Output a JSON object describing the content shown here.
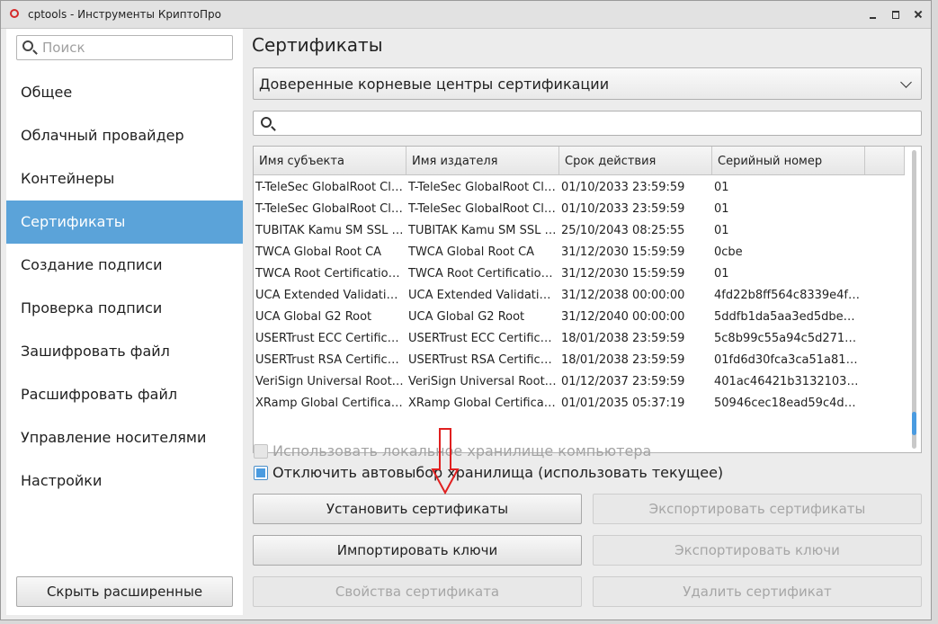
{
  "window": {
    "title": "cptools - Инструменты КриптоПро",
    "minimize_icon": "minimize-icon",
    "maximize_icon": "maximize-icon",
    "close_icon": "close-icon"
  },
  "sidebar": {
    "search_placeholder": "Поиск",
    "items": [
      {
        "label": "Общее",
        "active": false
      },
      {
        "label": "Облачный провайдер",
        "active": false
      },
      {
        "label": "Контейнеры",
        "active": false
      },
      {
        "label": "Сертификаты",
        "active": true
      },
      {
        "label": "Создание подписи",
        "active": false
      },
      {
        "label": "Проверка подписи",
        "active": false
      },
      {
        "label": "Зашифровать файл",
        "active": false
      },
      {
        "label": "Расшифровать файл",
        "active": false
      },
      {
        "label": "Управление носителями",
        "active": false
      },
      {
        "label": "Настройки",
        "active": false
      }
    ],
    "hide_button": "Скрыть расширенные"
  },
  "main": {
    "heading": "Сертификаты",
    "store_select": "Доверенные корневые центры сертификации",
    "filter_value": "",
    "table": {
      "columns": [
        "Имя субъекта",
        "Имя издателя",
        "Срок действия",
        "Серийный номер"
      ],
      "rows": [
        [
          "T-TeleSec GlobalRoot Clas...",
          "T-TeleSec GlobalRoot Clas...",
          "01/10/2033 23:59:59",
          "01"
        ],
        [
          "T-TeleSec GlobalRoot Clas...",
          "T-TeleSec GlobalRoot Clas...",
          "01/10/2033 23:59:59",
          "01"
        ],
        [
          "TUBITAK Kamu SM SSL K...",
          "TUBITAK Kamu SM SSL K...",
          "25/10/2043 08:25:55",
          "01"
        ],
        [
          "TWCA Global Root CA",
          "TWCA Global Root CA",
          "31/12/2030 15:59:59",
          "0cbe"
        ],
        [
          "TWCA Root Certification ...",
          "TWCA Root Certification ...",
          "31/12/2030 15:59:59",
          "01"
        ],
        [
          "UCA Extended Validation ...",
          "UCA Extended Validation ...",
          "31/12/2038 00:00:00",
          "4fd22b8ff564c8339e4f345..."
        ],
        [
          "UCA Global G2 Root",
          "UCA Global G2 Root",
          "31/12/2040 00:00:00",
          "5ddfb1da5aa3ed5dbe5a6..."
        ],
        [
          "USERTrust ECC Certificati...",
          "USERTrust ECC Certificati...",
          "18/01/2038 23:59:59",
          "5c8b99c55a94c5d27156d..."
        ],
        [
          "USERTrust RSA Certificati...",
          "USERTrust RSA Certificati...",
          "18/01/2038 23:59:59",
          "01fd6d30fca3ca51a81bbc..."
        ],
        [
          "VeriSign Universal Root C...",
          "VeriSign Universal Root C...",
          "01/12/2037 23:59:59",
          "401ac46421b31321030eb..."
        ],
        [
          "XRamp Global Certificatio...",
          "XRamp Global Certificatio...",
          "01/01/2035 05:37:19",
          "50946cec18ead59c4dd59..."
        ]
      ],
      "scroll_position": 0.95
    },
    "checkboxes": [
      {
        "label": "Использовать локальное хранилище компьютера",
        "checked": false,
        "enabled": false
      },
      {
        "label": "Отключить автовыбор хранилища (использовать текущее)",
        "checked": true,
        "enabled": true
      }
    ],
    "buttons": {
      "install": "Установить сертификаты",
      "export_certs": "Экспортировать сертификаты",
      "import_keys": "Импортировать ключи",
      "export_keys": "Экспортировать ключи",
      "cert_props": "Свойства сертификата",
      "delete_cert": "Удалить сертификат"
    }
  },
  "colors": {
    "accent": "#5ba3d9",
    "annotation_arrow": "#e02020"
  }
}
